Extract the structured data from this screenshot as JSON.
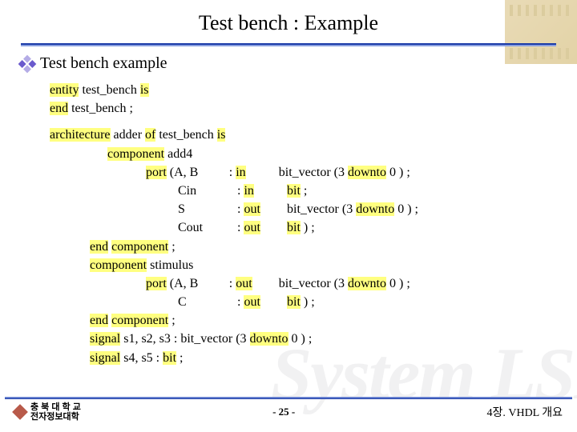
{
  "title": "Test bench : Example",
  "bullet": "Test bench example",
  "kw": {
    "entity": "entity",
    "is": "is",
    "end": "end",
    "architecture": "architecture",
    "of": "of",
    "component": "component",
    "port": "port",
    "in": "in",
    "out": "out",
    "downto": "downto",
    "signal": "signal",
    "bit": "bit"
  },
  "code": {
    "entity_name": "test_bench",
    "arch_name": "adder",
    "comp1": "add4",
    "comp2": "stimulus",
    "ports1": {
      "AB": "(A, B",
      "Cin": "Cin",
      "S": "S",
      "Cout": "Cout"
    },
    "ports2": {
      "AB": "(A, B",
      "C": "C"
    },
    "type_bv": "bit_vector",
    "range3": "(3",
    "zero_close": "0 ) ;",
    "bit_close": ") ;",
    "bit_semi": ";",
    "sig_line1_names": "s1, s2, s3 :",
    "sig_line1_type": "bit_vector",
    "sig_line1_range": "(3",
    "sig_line1_end": "0 ) ;",
    "sig_line2_names": "s4, s5 :",
    "sig_line2_end": ";"
  },
  "footer": {
    "org1": "충 북 대 학 교",
    "org2": "전자정보대학",
    "page": "-  25  -",
    "chapter": "4장. VHDL 개요"
  },
  "watermark": "System LSI"
}
